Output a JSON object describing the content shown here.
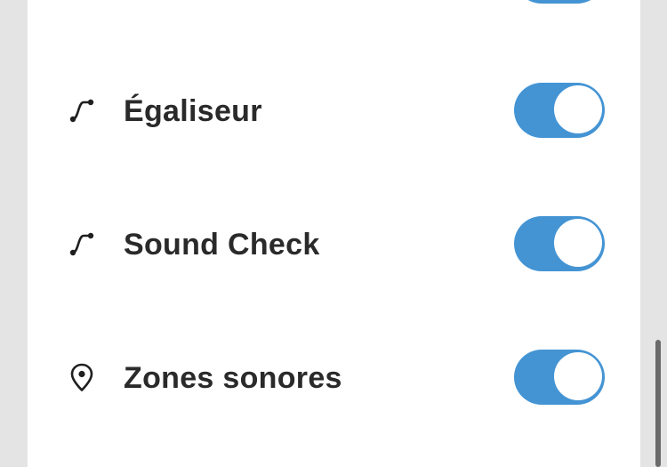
{
  "settings": {
    "rows": [
      {
        "label": "Égaliseur",
        "icon": "equalizer-curve-icon",
        "toggle_on": true
      },
      {
        "label": "Sound Check",
        "icon": "equalizer-curve-icon",
        "toggle_on": true
      },
      {
        "label": "Zones sonores",
        "icon": "location-pin-icon",
        "toggle_on": true
      }
    ]
  },
  "colors": {
    "toggle_on": "#4494d4",
    "panel": "#ffffff",
    "background": "#e4e4e4",
    "text": "#2a2a2a"
  }
}
